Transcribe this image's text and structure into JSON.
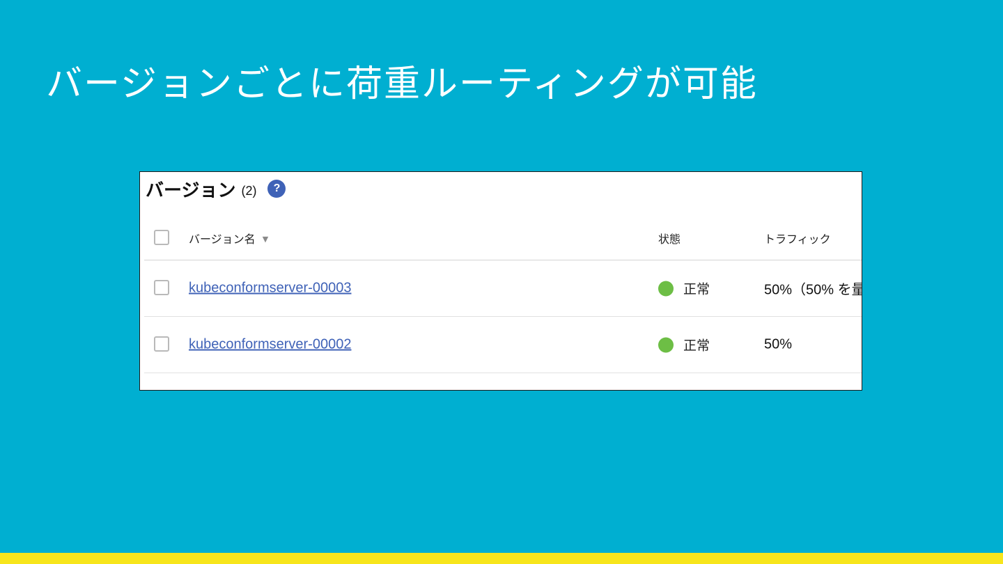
{
  "slide": {
    "title": "バージョンごとに荷重ルーティングが可能"
  },
  "panel": {
    "title": "バージョン",
    "count": "(2)",
    "help_icon_glyph": "?"
  },
  "table": {
    "headers": {
      "name": "バージョン名",
      "status": "状態",
      "traffic": "トラフィック"
    },
    "sort_icon": "sort-descending-icon",
    "rows": [
      {
        "name": "kubeconformserver-00003",
        "status": "正常",
        "traffic": "50%（50% を量"
      },
      {
        "name": "kubeconformserver-00002",
        "status": "正常",
        "traffic": "50%"
      }
    ]
  },
  "colors": {
    "background": "#00AFD1",
    "accent_bar": "#F7E51C",
    "link": "#3F62B7",
    "status_ok": "#6DBE45",
    "help_icon": "#3F62B7"
  }
}
